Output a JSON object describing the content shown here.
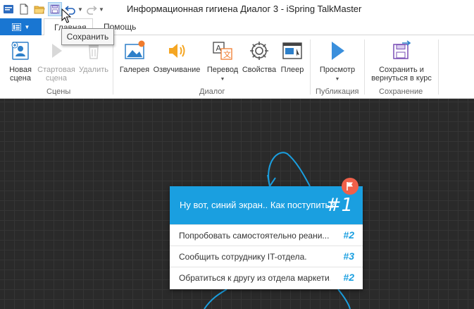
{
  "window": {
    "title": "Информационная гигиена Диалог 3 - iSpring TalkMaster"
  },
  "tabs": [
    {
      "label": "Главная"
    },
    {
      "label": "Помощь"
    }
  ],
  "tooltip": {
    "text": "Сохранить"
  },
  "ribbon": {
    "groups": [
      {
        "label": "Сцены"
      },
      {
        "label": "Диалог"
      },
      {
        "label": "Публикация"
      },
      {
        "label": "Сохранение"
      }
    ],
    "buttons": {
      "new_scene": {
        "line1": "Новая",
        "line2": "сцена"
      },
      "start_scene": {
        "line1": "Стартовая",
        "line2": "сцена"
      },
      "delete": {
        "line1": "Удалить"
      },
      "gallery": {
        "line1": "Галерея"
      },
      "voice": {
        "line1": "Озвучивание"
      },
      "translate": {
        "line1": "Перевод"
      },
      "properties": {
        "line1": "Свойства"
      },
      "player": {
        "line1": "Плеер"
      },
      "preview": {
        "line1": "Просмотр"
      },
      "save_return": {
        "line1": "Сохранить и",
        "line2": "вернуться в курс"
      }
    }
  },
  "scene": {
    "question": "Ну вот, синий экран.. Как поступить?",
    "number": "#1",
    "answers": [
      {
        "text": "Попробовать самостоятельно реани...",
        "link": "#2"
      },
      {
        "text": "Сообщить сотруднику IT-отдела.",
        "link": "#3"
      },
      {
        "text": "Обратиться к другу из отдела маркети...",
        "link": "#2"
      }
    ]
  },
  "colors": {
    "accent": "#1a9fe0",
    "file_tab": "#1976d2",
    "flag": "#f0604a",
    "canvas": "#2a2a2a"
  }
}
